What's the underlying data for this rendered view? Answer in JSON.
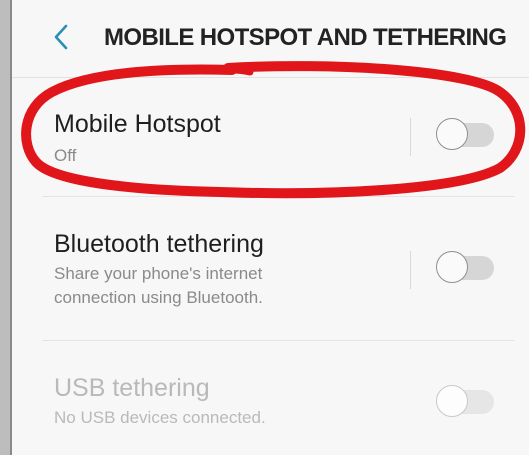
{
  "header": {
    "back_icon": "chevron-left-icon",
    "title": "MOBILE HOTSPOT AND TETHERING"
  },
  "rows": [
    {
      "title": "Mobile Hotspot",
      "subtitle": "Off",
      "toggle": "off",
      "enabled": true
    },
    {
      "title": "Bluetooth tethering",
      "subtitle_line1": "Share your phone's internet",
      "subtitle_line2": "connection using Bluetooth.",
      "toggle": "off",
      "enabled": true
    },
    {
      "title": "USB tethering",
      "subtitle": "No USB devices connected.",
      "toggle": "off",
      "enabled": false
    }
  ],
  "colors": {
    "accent": "#2a8fb5",
    "annotation": "#e0161b"
  }
}
